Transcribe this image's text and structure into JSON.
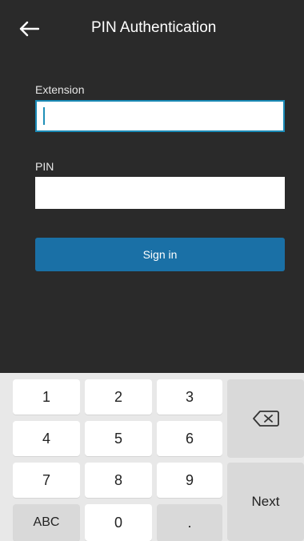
{
  "header": {
    "title": "PIN Authentication",
    "back_icon": "arrow-left-icon"
  },
  "form": {
    "extension_label": "Extension",
    "extension_value": "",
    "pin_label": "PIN",
    "pin_value": "",
    "signin_label": "Sign in"
  },
  "keyboard": {
    "keys": [
      "1",
      "2",
      "3",
      "4",
      "5",
      "6",
      "7",
      "8",
      "9",
      "ABC",
      "0",
      "."
    ],
    "backspace_icon": "backspace-icon",
    "next_label": "Next"
  },
  "colors": {
    "background": "#2a2a2a",
    "accent": "#1a70a6",
    "focus_border": "#1a8ab6",
    "keyboard_bg": "#e8e8e8"
  }
}
